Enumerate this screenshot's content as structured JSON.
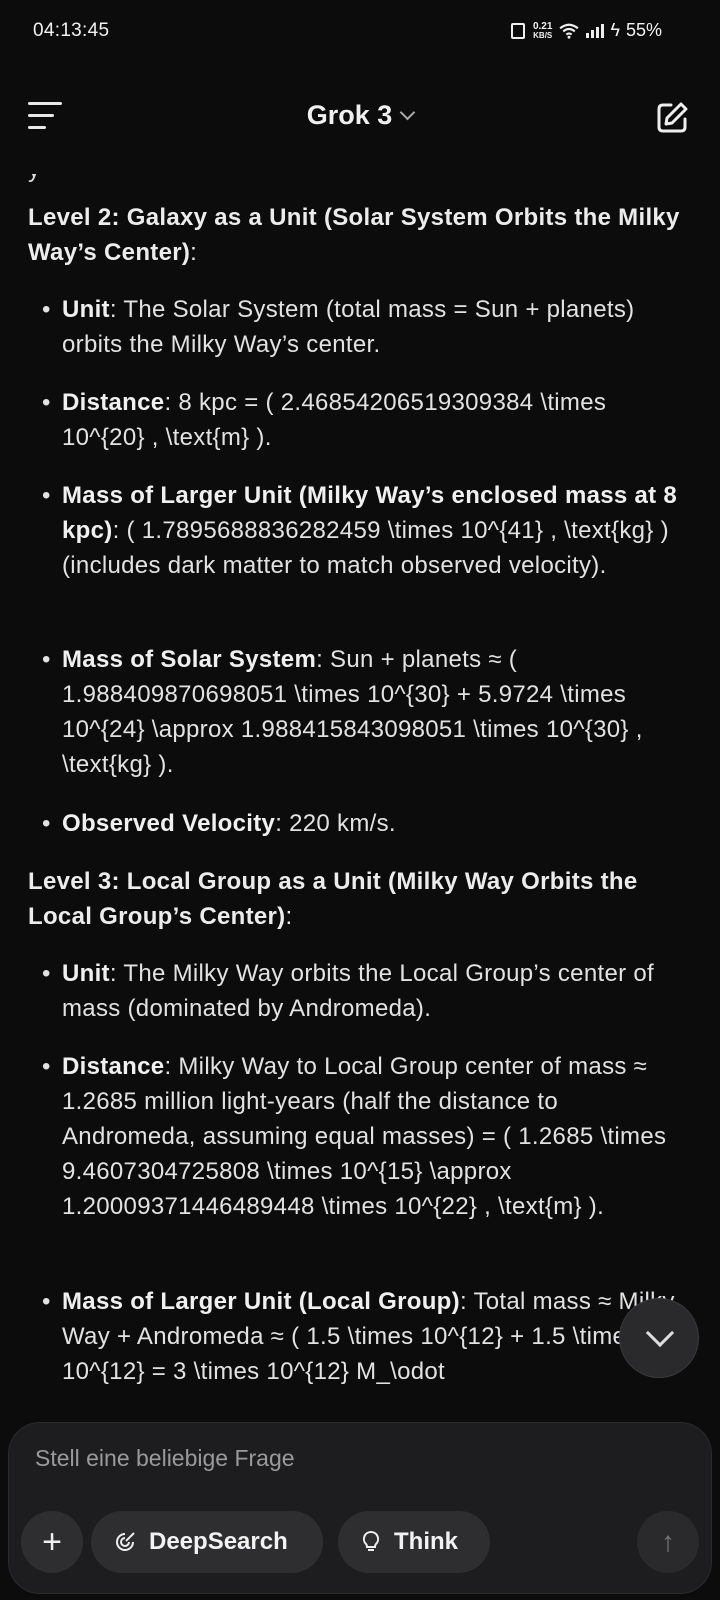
{
  "status": {
    "time": "04:13:45",
    "net_speed_top": "0.21",
    "net_speed_bottom": "KB/S",
    "battery": "55%"
  },
  "header": {
    "title": "Grok 3"
  },
  "content": {
    "partial_line": "y",
    "level2": {
      "heading": "Level 2: Galaxy as a Unit (Solar System Orbits the Milky Way’s Center)",
      "colon": ":",
      "items": [
        {
          "label": "Unit",
          "text": ": The Solar System (total mass = Sun + planets) orbits the Milky Way’s center."
        },
        {
          "label": "Distance",
          "text": ": 8 kpc = ( 2.46854206519309384 \\times 10^{20} , \\text{m} )."
        },
        {
          "label": "Mass of Larger Unit (Milky Way’s enclosed mass at 8 kpc)",
          "text": ": ( 1.7895688836282459 \\times 10^{41} , \\text{kg} ) (includes dark matter to match observed velocity)."
        },
        {
          "label": "Mass of Solar System",
          "text": ": Sun + planets ≈ ( 1.988409870698051 \\times 10^{30} + 5.9724 \\times 10^{24} \\approx 1.988415843098051 \\times 10^{30} , \\text{kg} )."
        },
        {
          "label": "Observed Velocity",
          "text": ": 220 km/s."
        }
      ]
    },
    "level3": {
      "heading": "Level 3: Local Group as a Unit (Milky Way Orbits the Local Group’s Center)",
      "colon": ":",
      "items": [
        {
          "label": "Unit",
          "text": ": The Milky Way orbits the Local Group’s center of mass (dominated by Andromeda)."
        },
        {
          "label": "Distance",
          "text": ": Milky Way to Local Group center of mass ≈ 1.2685 million light-years (half the distance to Andromeda, assuming equal masses) = ( 1.2685 \\times 9.4607304725808 \\times 10^{15} \\approx 1.20009371446489448 \\times 10^{22} , \\text{m} )."
        },
        {
          "label": "Mass of Larger Unit (Local Group)",
          "text": ": Total mass ≈ Milky Way + Andromeda ≈ ( 1.5 \\times 10^{12} + 1.5 \\times 10^{12} = 3 \\times 10^{12} M_\\odot"
        }
      ]
    }
  },
  "composer": {
    "placeholder": "Stell eine beliebige Frage",
    "deepsearch_label": "DeepSearch",
    "think_label": "Think",
    "plus_label": "+"
  }
}
